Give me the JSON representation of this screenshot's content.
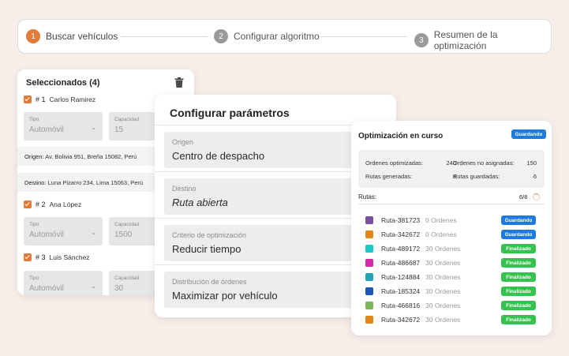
{
  "stepper": {
    "steps": [
      {
        "num": "1",
        "label": "Buscar vehículos"
      },
      {
        "num": "2",
        "label": "Configurar algoritmo"
      },
      {
        "num": "3",
        "label": "Resumen de la optimización"
      }
    ],
    "active_color": "#e07b38",
    "inactive_color": "#9a9a9a"
  },
  "selected": {
    "title": "Seleccionados (4)",
    "vehicles": [
      {
        "num": "# 1",
        "name": "Carlos Ramirez",
        "tipo_label": "Tipo",
        "tipo_value": "Automóvil",
        "cap_label": "Capacidad",
        "cap_value": "15"
      },
      {
        "num": "# 2",
        "name": "Ana López",
        "tipo_label": "Tipo",
        "tipo_value": "Automóvil",
        "cap_label": "Capacidad",
        "cap_value": "1500"
      },
      {
        "num": "# 3",
        "name": "Luis Sánchez",
        "tipo_label": "Tipo",
        "tipo_value": "Automóvil",
        "cap_label": "Capacidad",
        "cap_value": "30"
      }
    ],
    "origen_label": "Origen:",
    "origen_value": "Av. Bolivia 951, Breña 15082, Perú",
    "destino_label": "Destino:",
    "destino_value": "Luna Pizarro 234, Lima 15063, Perú"
  },
  "config": {
    "title": "Configurar parámetros",
    "fields": [
      {
        "label": "Origen",
        "value": "Centro de despacho"
      },
      {
        "label": "Destino",
        "value": "Ruta abierta"
      },
      {
        "label": "Criterio de optimización",
        "value": "Reducir tiempo"
      },
      {
        "label": "Distribución de órdenes",
        "value": "Maximizar por vehículo"
      }
    ]
  },
  "optimization": {
    "title": "Optimización en curso",
    "status_badge": "Guardando",
    "stats": {
      "opt_label": "Ordenes optimizadas:",
      "opt_value": "240",
      "noasig_label": "Ordenes no asignadas:",
      "noasig_value": "150",
      "gen_label": "Rutas generadas:",
      "gen_value": "8",
      "guard_label": "Rutas guardadas:",
      "guard_value": "6"
    },
    "rutas_label": "Rutas:",
    "rutas_count": "6/8",
    "routes": [
      {
        "name": "Ruta-381723",
        "orders": "0 Ordenes",
        "color": "#7b4fa3",
        "status": "Guardando",
        "status_color": "#1f7ae0"
      },
      {
        "name": "Ruta-342672",
        "orders": "0 Ordenes",
        "color": "#e0861a",
        "status": "Guardando",
        "status_color": "#1f7ae0"
      },
      {
        "name": "Ruta-489172",
        "orders": "30 Ordenes",
        "color": "#1fc7c7",
        "status": "Finalizado",
        "status_color": "#35c24e"
      },
      {
        "name": "Ruta-486687",
        "orders": "30 Ordenes",
        "color": "#d42aa8",
        "status": "Finalizado",
        "status_color": "#35c24e"
      },
      {
        "name": "Ruta-124884",
        "orders": "30 Ordenes",
        "color": "#22a3b8",
        "status": "Finalizado",
        "status_color": "#35c24e"
      },
      {
        "name": "Ruta-185324",
        "orders": "30 Ordenes",
        "color": "#1d55b8",
        "status": "Finalizado",
        "status_color": "#35c24e"
      },
      {
        "name": "Ruta-466816",
        "orders": "30 Ordenes",
        "color": "#7ab85a",
        "status": "Finalizado",
        "status_color": "#35c24e"
      },
      {
        "name": "Ruta-342672",
        "orders": "30 Ordenes",
        "color": "#e0861a",
        "status": "Finalizado",
        "status_color": "#35c24e"
      }
    ]
  }
}
